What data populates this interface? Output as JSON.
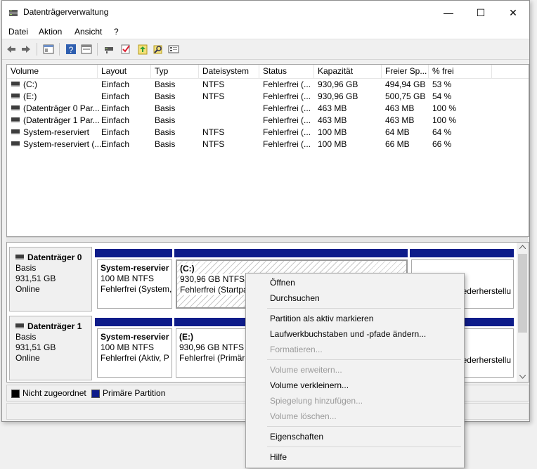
{
  "window": {
    "title": "Datenträgerverwaltung",
    "minimize_glyph": "—",
    "maximize_glyph": "☐",
    "close_glyph": "✕"
  },
  "menu": [
    "Datei",
    "Aktion",
    "Ansicht",
    "?"
  ],
  "toolbar": [
    "back-icon",
    "forward-icon",
    "properties-icon",
    "help-icon",
    "view-icon",
    "connect-icon",
    "checklist-icon",
    "refresh-icon",
    "search-icon",
    "console-icon"
  ],
  "volume_list": {
    "headers": [
      "Volume",
      "Layout",
      "Typ",
      "Dateisystem",
      "Status",
      "Kapazität",
      "Freier Sp...",
      "% frei"
    ],
    "rows": [
      [
        "(C:)",
        "Einfach",
        "Basis",
        "NTFS",
        "Fehlerfrei (...",
        "930,96 GB",
        "494,94 GB",
        "53 %"
      ],
      [
        "(E:)",
        "Einfach",
        "Basis",
        "NTFS",
        "Fehlerfrei (...",
        "930,96 GB",
        "500,75 GB",
        "54 %"
      ],
      [
        "(Datenträger 0 Par...",
        "Einfach",
        "Basis",
        "",
        "Fehlerfrei (...",
        "463 MB",
        "463 MB",
        "100 %"
      ],
      [
        "(Datenträger 1 Par...",
        "Einfach",
        "Basis",
        "",
        "Fehlerfrei (...",
        "463 MB",
        "463 MB",
        "100 %"
      ],
      [
        "System-reserviert",
        "Einfach",
        "Basis",
        "NTFS",
        "Fehlerfrei (...",
        "100 MB",
        "64 MB",
        "64 %"
      ],
      [
        "System-reserviert (...",
        "Einfach",
        "Basis",
        "NTFS",
        "Fehlerfrei (...",
        "100 MB",
        "66 MB",
        "66 %"
      ]
    ]
  },
  "disks": [
    {
      "name": "Datenträger 0",
      "type": "Basis",
      "size": "931,51 GB",
      "state": "Online",
      "partitions": [
        {
          "name": "System-reservier",
          "size": "100 MB NTFS",
          "status": "Fehlerfrei (System,"
        },
        {
          "name": "(C:)",
          "size": "930,96 GB NTFS",
          "status": "Fehlerfrei (Startpar"
        },
        {
          "name": "",
          "size": "",
          "status": "ederherstellu"
        }
      ]
    },
    {
      "name": "Datenträger 1",
      "type": "Basis",
      "size": "931,51 GB",
      "state": "Online",
      "partitions": [
        {
          "name": "System-reservier",
          "size": "100 MB NTFS",
          "status": "Fehlerfrei (Aktiv, P"
        },
        {
          "name": "(E:)",
          "size": "930,96 GB NTFS",
          "status": "Fehlerfrei (Primäre"
        },
        {
          "name": "",
          "size": "",
          "status": "ederherstellu"
        }
      ]
    }
  ],
  "legend": [
    {
      "label": "Nicht zugeordnet",
      "color": "#000000"
    },
    {
      "label": "Primäre Partition",
      "color": "#0e1c8a"
    }
  ],
  "context_menu": [
    {
      "label": "Öffnen",
      "enabled": true
    },
    {
      "label": "Durchsuchen",
      "enabled": true
    },
    {
      "label": "Partition als aktiv markieren",
      "enabled": true
    },
    {
      "label": "Laufwerkbuchstaben und -pfade ändern...",
      "enabled": true
    },
    {
      "label": "Formatieren...",
      "enabled": false
    },
    {
      "label": "Volume erweitern...",
      "enabled": false
    },
    {
      "label": "Volume verkleinern...",
      "enabled": true
    },
    {
      "label": "Spiegelung hinzufügen...",
      "enabled": false
    },
    {
      "label": "Volume löschen...",
      "enabled": false
    },
    {
      "label": "Eigenschaften",
      "enabled": true
    },
    {
      "label": "Hilfe",
      "enabled": true
    }
  ]
}
